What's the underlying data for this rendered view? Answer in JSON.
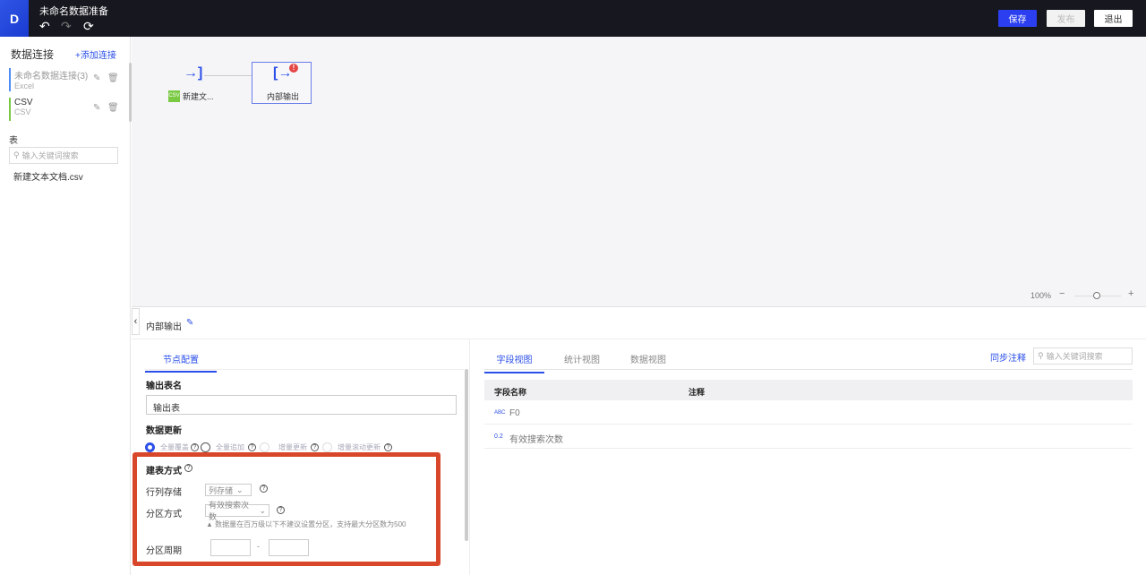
{
  "header": {
    "title": "未命名数据准备",
    "logo": "D",
    "save": "保存",
    "publish": "发布",
    "exit": "退出",
    "icons": [
      "undo-icon",
      "redo-icon",
      "refresh-icon"
    ]
  },
  "sidebar": {
    "title": "数据连接",
    "add": "+添加连接",
    "connections": [
      {
        "name": "未命名数据连接(3)",
        "type": "Excel",
        "color": "#4d8cf5"
      },
      {
        "name": "CSV",
        "type": "CSV",
        "color": "#7ac943"
      }
    ],
    "tables_title": "表",
    "search_placeholder": "输入关键词搜索",
    "tables": [
      "新建文本文档.csv"
    ]
  },
  "canvas": {
    "nodes": [
      {
        "label": "新建文...",
        "badge": "CSV"
      },
      {
        "label": "内部输出",
        "error": "!"
      }
    ],
    "zoom": "100%",
    "zoom_minus": "−",
    "zoom_plus": "+",
    "zoom_level": 0.5
  },
  "panel": {
    "node_title": "内部输出",
    "collapse": "‹",
    "tab": "节点配置",
    "output_name_label": "输出表名",
    "output_name_value": "输出表",
    "update_label": "数据更新",
    "update_options": [
      "全量覆盖",
      "全量追加",
      "增量更新",
      "增量滚动更新"
    ],
    "update_selected": "全量覆盖",
    "build_label": "建表方式",
    "storage_label": "行列存储",
    "storage_value": "列存储",
    "partition_label": "分区方式",
    "partition_value": "有效搜索次数",
    "warning": "数据量在百万级以下不建议设置分区，支持最大分区数为500",
    "period_label": "分区周期",
    "period_sep": "-"
  },
  "fields": {
    "tabs": [
      "字段视图",
      "统计视图",
      "数据视图"
    ],
    "active_tab": "字段视图",
    "sync": "同步注释",
    "search_placeholder": "输入关键词搜索",
    "columns": [
      "字段名称",
      "注释"
    ],
    "rows": [
      {
        "type": "ABC",
        "name": "F0",
        "comment": ""
      },
      {
        "type": "0.2",
        "name": "有效搜索次数",
        "comment": ""
      }
    ]
  },
  "colors": {
    "accent": "#2b4fe8",
    "header_bg": "#17181f",
    "highlight": "#d9472b"
  }
}
